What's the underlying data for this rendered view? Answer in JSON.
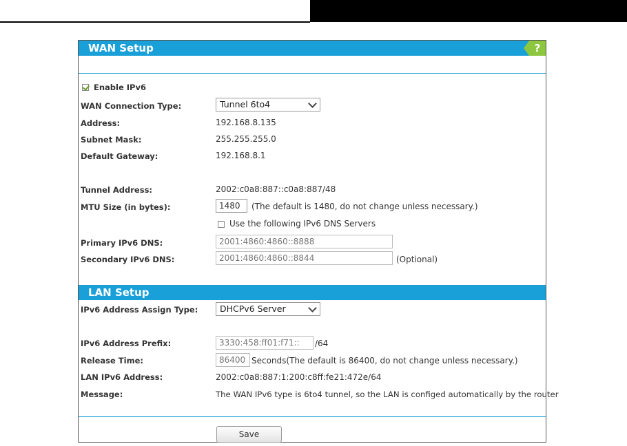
{
  "wan": {
    "title": "WAN Setup",
    "help_label": "?",
    "enable_ipv6_label": "Enable IPv6",
    "connection_type_label": "WAN Connection Type:",
    "connection_type_value": "Tunnel 6to4",
    "address_label": "Address:",
    "address_value": "192.168.8.135",
    "subnet_label": "Subnet Mask:",
    "subnet_value": "255.255.255.0",
    "gateway_label": "Default Gateway:",
    "gateway_value": "192.168.8.1",
    "tunnel_label": "Tunnel Address:",
    "tunnel_value": "2002:c0a8:887::c0a8:887/48",
    "mtu_label": "MTU Size (in bytes):",
    "mtu_value": "1480",
    "mtu_note": "(The default is 1480, do not change unless necessary.)",
    "use_dns_label": "Use the following IPv6 DNS Servers",
    "primary_dns_label": "Primary IPv6 DNS:",
    "primary_dns_value": "2001:4860:4860::8888",
    "secondary_dns_label": "Secondary IPv6 DNS:",
    "secondary_dns_value": "2001:4860:4860::8844",
    "optional_note": "(Optional)"
  },
  "lan": {
    "title": "LAN Setup",
    "assign_type_label": "IPv6 Address Assign Type:",
    "assign_type_value": "DHCPv6 Server",
    "prefix_label": "IPv6 Address Prefix:",
    "prefix_value": "3330:458:ff01:f71::",
    "prefix_suffix": "/64",
    "release_label": "Release Time:",
    "release_value": "86400",
    "release_note": "Seconds(The default is 86400, do not change unless necessary.)",
    "lan_addr_label": "LAN IPv6 Address:",
    "lan_addr_value": "2002:c0a8:887:1:200:c8ff:fe21:472e/64",
    "message_label": "Message:",
    "message_value": "The WAN IPv6 type is 6to4 tunnel, so the LAN is configed automatically by the router"
  },
  "save_label": "Save",
  "colors": {
    "accent": "#19a0d8",
    "help": "#8dc63f"
  }
}
